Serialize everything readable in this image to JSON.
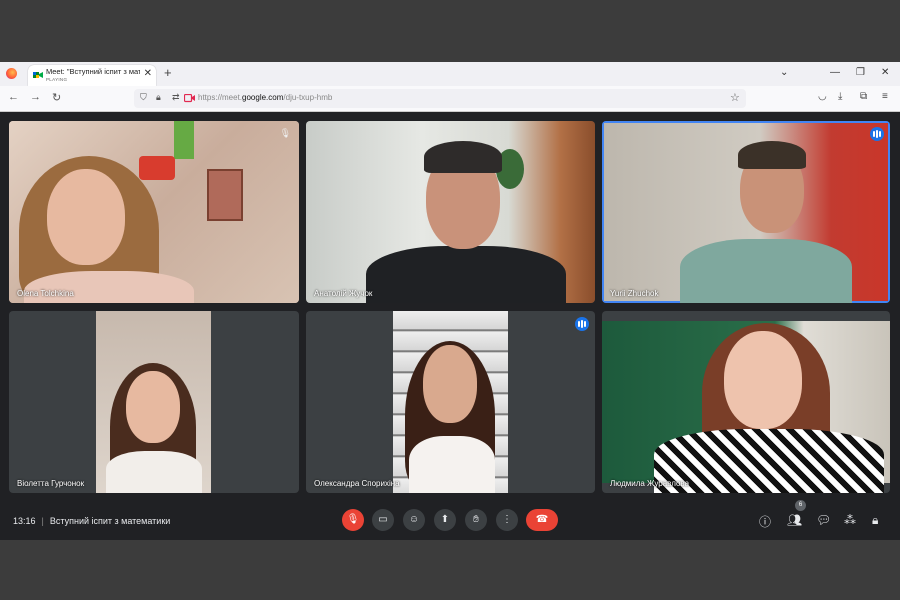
{
  "browser": {
    "tab_title": "Meet: \"Вступний іспит з матем",
    "tab_status": "PLAYING",
    "url_prefix": "https://meet.",
    "url_domain": "google.com",
    "url_path": "/dju-txup-hmb"
  },
  "participants": [
    {
      "name": "Olena Tolchkina",
      "active": false
    },
    {
      "name": "Анатолій Жучок",
      "active": false
    },
    {
      "name": "Yurii Zhuchok",
      "active": true
    },
    {
      "name": "Віолетта Гурчонок",
      "active": false
    },
    {
      "name": "Олександра Спорихіна",
      "active": false
    },
    {
      "name": "Людмила Журавлова",
      "active": false
    }
  ],
  "meeting": {
    "time": "13:16",
    "title": "Вступний іспит з математики",
    "participant_count": "6"
  },
  "colors": {
    "accent": "#1a73e8",
    "hangup": "#ea4335",
    "tile_bg": "#3c4043",
    "bar_bg": "#202124"
  }
}
